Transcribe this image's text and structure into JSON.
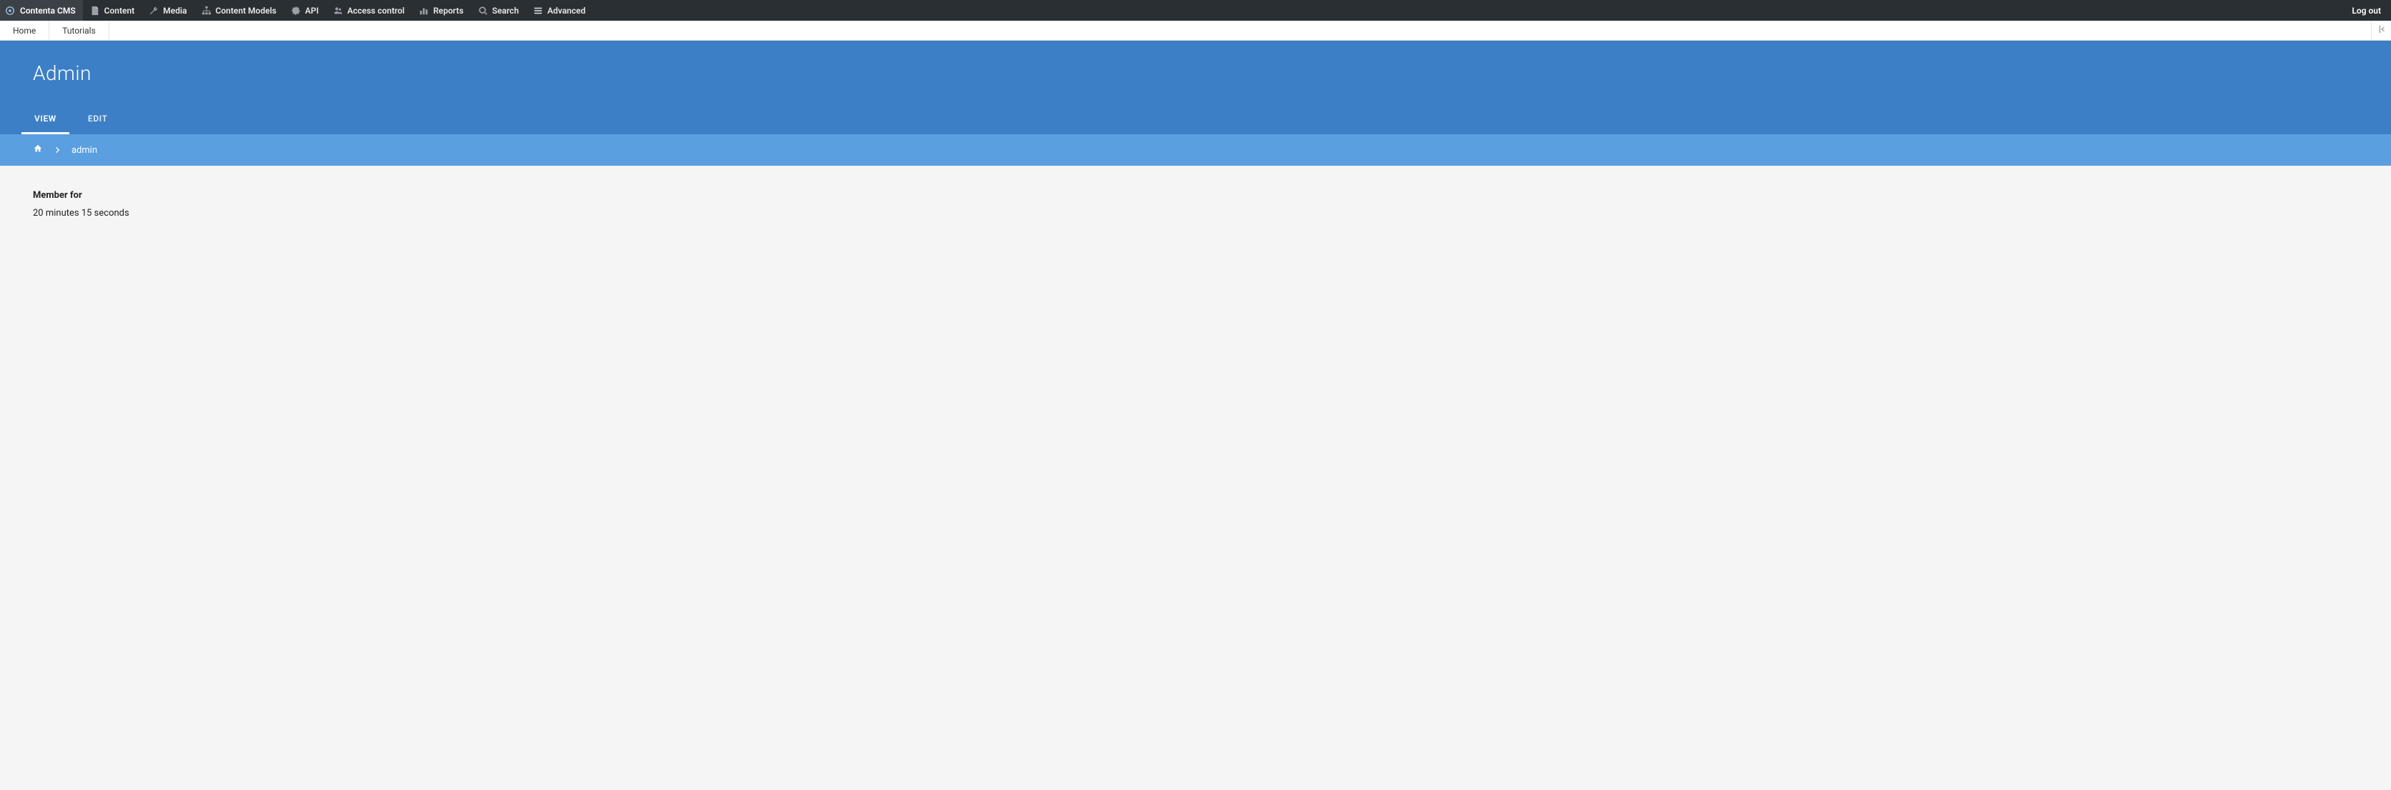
{
  "toolbar": {
    "brand": "Contenta CMS",
    "items": [
      {
        "id": "content",
        "label": "Content",
        "icon": "file-icon"
      },
      {
        "id": "media",
        "label": "Media",
        "icon": "wrench-icon"
      },
      {
        "id": "content-models",
        "label": "Content Models",
        "icon": "sitemap-icon"
      },
      {
        "id": "api",
        "label": "API",
        "icon": "puzzle-icon"
      },
      {
        "id": "access-control",
        "label": "Access control",
        "icon": "users-icon"
      },
      {
        "id": "reports",
        "label": "Reports",
        "icon": "bar-chart-icon"
      },
      {
        "id": "search",
        "label": "Search",
        "icon": "search-icon"
      },
      {
        "id": "advanced",
        "label": "Advanced",
        "icon": "menu-icon"
      }
    ],
    "logout": "Log out"
  },
  "subbar": {
    "items": [
      {
        "id": "home",
        "label": "Home"
      },
      {
        "id": "tutorials",
        "label": "Tutorials"
      }
    ]
  },
  "page": {
    "title": "Admin",
    "tabs": [
      {
        "id": "view",
        "label": "VIEW",
        "active": true
      },
      {
        "id": "edit",
        "label": "EDIT",
        "active": false
      }
    ]
  },
  "breadcrumb": {
    "current": "admin"
  },
  "profile": {
    "member_for_label": "Member for",
    "member_for_value": "20 minutes 15 seconds"
  }
}
